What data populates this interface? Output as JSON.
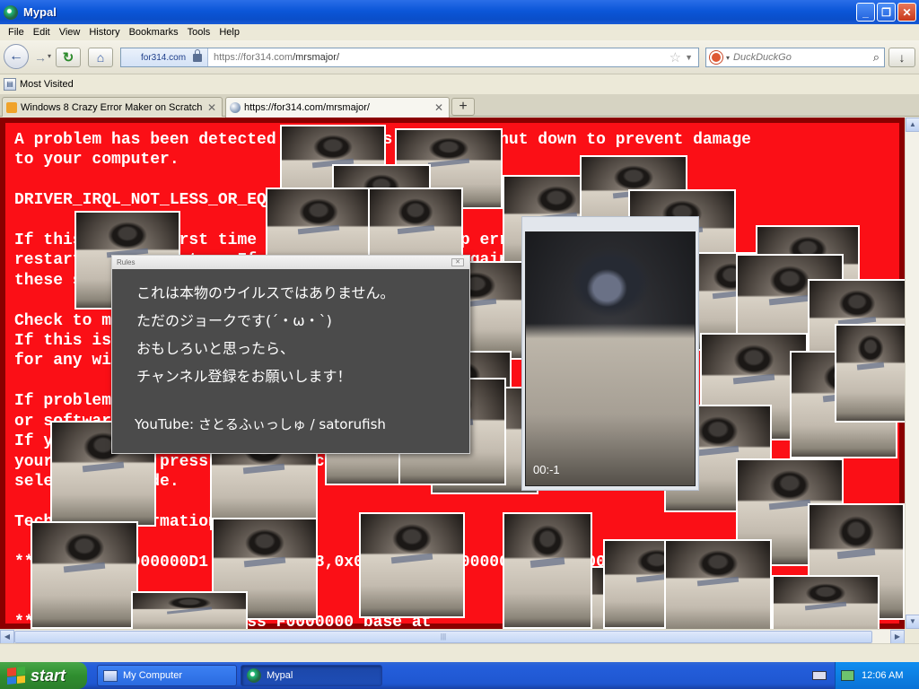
{
  "window": {
    "title": "Mypal",
    "minimize": "_",
    "maximize": "❐",
    "close": "✕"
  },
  "menu": [
    "File",
    "Edit",
    "View",
    "History",
    "Bookmarks",
    "Tools",
    "Help"
  ],
  "nav": {
    "identity": "for314.com",
    "url_host": "https://for314.com",
    "url_path": "/mrsmajor/",
    "search_placeholder": "DuckDuckGo"
  },
  "bookmarks": {
    "most_visited": "Most Visited"
  },
  "tabs": [
    {
      "label": "Windows 8 Crazy Error Maker on Scratch",
      "active": false
    },
    {
      "label": "https://for314.com/mrsmajor/",
      "active": true
    }
  ],
  "bsod_lines": [
    "A problem has been detected and Windows has been shut down to prevent damage",
    "to your computer.",
    "",
    "DRIVER_IRQL_NOT_LESS_OR_EQUAL",
    "",
    "If this is the first time you've seen this stop error screen,",
    "restart your computer. If this screen appears again, follow",
    "these steps:",
    "",
    "Check to make sure any new hardware or software is properly installed.",
    "If this is a new installation, ask your hardware or software manufacturer",
    "for any windows updates you might need.",
    "",
    "If problems continue, disable or remove any newly installed hardware",
    "or software. Disable BIOS memory options such as caching or shadowing.",
    "If you need to use Safe Mode to remove or disable components, restart",
    "your computer, press F8 to select Advanced Startup Options, and then",
    "select Safe Mode.",
    "",
    "Technical information:",
    "",
    "*** STOP: 0x000000D1 (0x00000008,0x00000002,0x00000001,0xF0000000)",
    "",
    "",
    "***   ndisrd.sys - Address F0000000 base at"
  ],
  "dialog": {
    "title": "Rules",
    "close": "✕",
    "lines": [
      "これは本物のウイルスではありません。",
      "ただのジョークです(´・ω・`)",
      "おもしろいと思ったら、",
      "チャンネル登録をお願いします！"
    ],
    "youtube": "YouTube:  さとるふぃっしゅ / satorufish"
  },
  "video": {
    "time": "00:-1"
  },
  "taskbar": {
    "start": "start",
    "tasks": [
      "My Computer",
      "Mypal"
    ],
    "clock": "12:06 AM"
  }
}
